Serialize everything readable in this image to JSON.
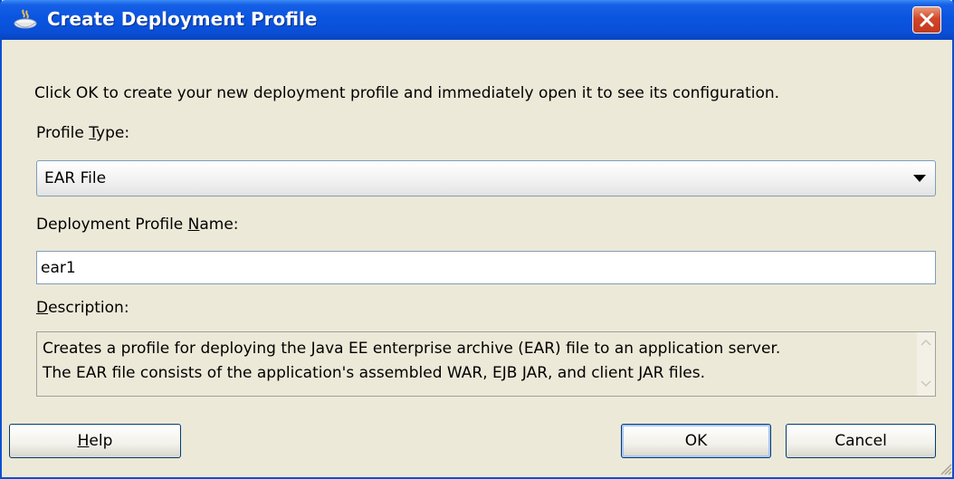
{
  "window": {
    "title": "Create Deployment Profile",
    "icon": "oracle-cup-icon",
    "close_icon": "close-icon"
  },
  "form": {
    "instruction": "Click OK to create your new deployment profile and immediately open it to see its configuration.",
    "profile_type_label_pre": "Profile ",
    "profile_type_label_mn": "T",
    "profile_type_label_post": "ype:",
    "profile_type_value": "EAR File",
    "name_label_pre": "Deployment Profile ",
    "name_label_mn": "N",
    "name_label_post": "ame:",
    "name_value": "ear1",
    "description_label_mn": "D",
    "description_label_post": "escription:",
    "description_line1": "Creates a profile for deploying the Java EE enterprise archive (EAR) file to an application server.",
    "description_line2": "The EAR file consists of the application's assembled WAR, EJB JAR, and client JAR files."
  },
  "buttons": {
    "help_mn": "H",
    "help_post": "elp",
    "ok": "OK",
    "cancel": "Cancel"
  }
}
